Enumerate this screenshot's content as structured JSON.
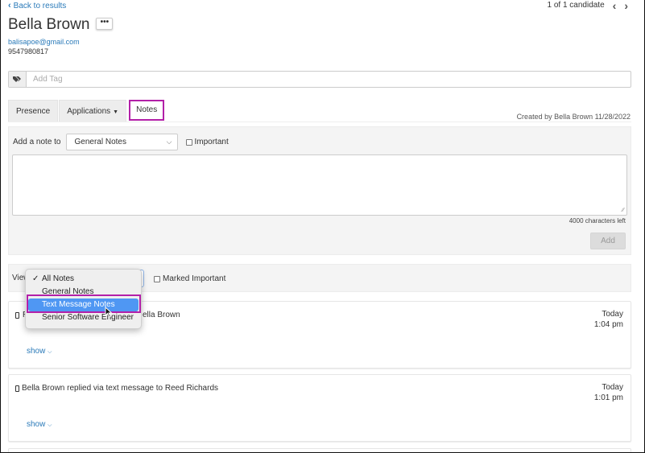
{
  "header": {
    "back_label": "Back to results",
    "pager_text": "1 of 1 candidate",
    "prev_icon": "chevron-left-icon",
    "next_icon": "chevron-right-icon"
  },
  "candidate": {
    "name": "Bella Brown",
    "more_label": "•••",
    "email": "balisapoe@gmail.com",
    "phone": "9547980817"
  },
  "tags": {
    "icon": "tag-icon",
    "placeholder": "Add Tag"
  },
  "tabs": [
    {
      "label": "Presence",
      "active": false
    },
    {
      "label": "Applications",
      "active": false,
      "has_caret": true
    },
    {
      "label": "Notes",
      "active": true
    }
  ],
  "created_by": "Created by Bella Brown 11/28/2022",
  "add_note": {
    "label": "Add a note to",
    "selected": "General Notes",
    "important_label": "Important",
    "important_checked": false,
    "text_value": "",
    "chars_left": "4000 characters left",
    "add_button": "Add"
  },
  "filter": {
    "view_label": "View",
    "marked_important_label": "Marked Important",
    "marked_important_checked": false,
    "options": [
      {
        "label": "All Notes",
        "checked": true
      },
      {
        "label": "General Notes",
        "checked": false
      },
      {
        "label": "Text Message Notes",
        "checked": false,
        "highlighted": true
      },
      {
        "label": "Senior Software Engineer",
        "checked": false
      }
    ]
  },
  "notes": [
    {
      "icon": "mobile-phone-icon",
      "text_visible_start": "R",
      "text_visible_end": "ella Brown",
      "date": "Today",
      "time": "1:04 pm",
      "show_label": "show"
    },
    {
      "icon": "mobile-phone-icon",
      "text": "Bella Brown replied via text message to Reed Richards",
      "date": "Today",
      "time": "1:01 pm",
      "show_label": "show"
    }
  ],
  "colors": {
    "link": "#2a7ab9",
    "highlight_outline": "#b320a8",
    "menu_highlight": "#4f97f3",
    "panel_bg": "#f4f4f4"
  }
}
